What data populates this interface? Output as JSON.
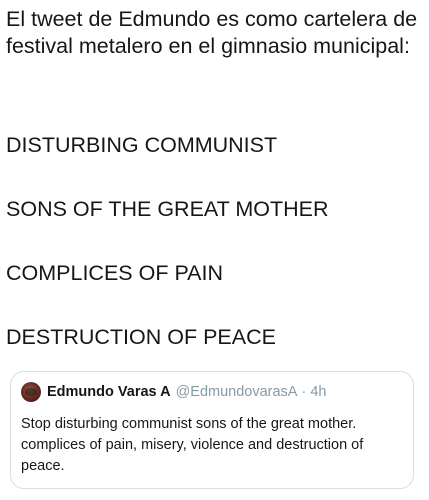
{
  "tweet": {
    "intro_text": "El tweet de Edmundo es como cartelera de festival metalero en el gimnasio municipal:",
    "bands": [
      "DISTURBING COMMUNIST",
      "SONS OF THE GREAT MOTHER",
      "COMPLICES OF PAIN",
      "DESTRUCTION OF PEACE"
    ]
  },
  "quoted_tweet": {
    "avatar_icon": "avatar-icon",
    "author_name": "Edmundo Varas A",
    "author_handle": "@EdmundovarasA",
    "separator": "·",
    "time": "4h",
    "text": "Stop disturbing communist sons of the great mother. complices of pain, misery, violence and destruction of peace."
  },
  "colors": {
    "text": "#14171a",
    "muted": "#8899a6",
    "border": "#d6dde3",
    "background": "#ffffff"
  }
}
